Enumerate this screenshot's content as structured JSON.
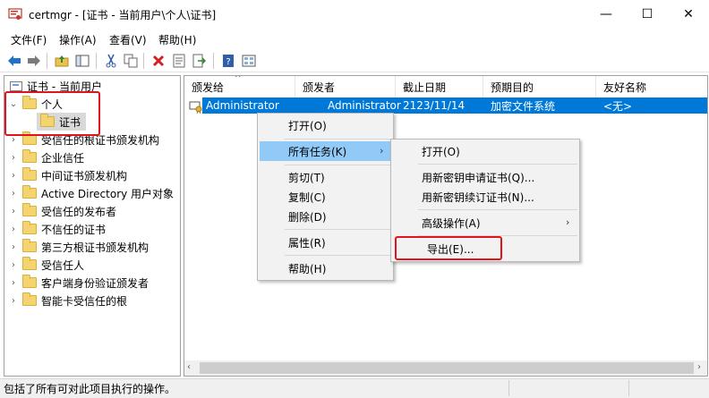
{
  "window": {
    "title": "certmgr - [证书 - 当前用户\\个人\\证书]",
    "controls": {
      "minimize": "—",
      "maximize": "☐",
      "close": "✕"
    }
  },
  "menubar": {
    "items": [
      "文件(F)",
      "操作(A)",
      "查看(V)",
      "帮助(H)"
    ]
  },
  "toolbar": {
    "icons": [
      "back-icon",
      "forward-icon",
      "up-folder-icon",
      "show-hide-tree-icon",
      "cut-icon",
      "copy-icon",
      "delete-icon",
      "properties-icon",
      "export-list-icon",
      "help-icon",
      "view-icon"
    ]
  },
  "tree": {
    "root": "证书 - 当前用户",
    "items": [
      {
        "label": "个人",
        "expanded": true
      },
      {
        "label": "证书",
        "child": true,
        "selected": true
      },
      {
        "label": "受信任的根证书颁发机构"
      },
      {
        "label": "企业信任"
      },
      {
        "label": "中间证书颁发机构"
      },
      {
        "label": "Active Directory 用户对象"
      },
      {
        "label": "受信任的发布者"
      },
      {
        "label": "不信任的证书"
      },
      {
        "label": "第三方根证书颁发机构"
      },
      {
        "label": "受信任人"
      },
      {
        "label": "客户端身份验证颁发者"
      },
      {
        "label": "智能卡受信任的根"
      }
    ]
  },
  "list": {
    "columns": [
      "颁发给",
      "颁发者",
      "截止日期",
      "预期目的",
      "友好名称"
    ],
    "rows": [
      {
        "issued_to": "Administrator",
        "issued_by": "Administrator",
        "expires": "2123/11/14",
        "purpose": "加密文件系统",
        "friendly": "<无>"
      }
    ]
  },
  "context_menu": {
    "items": [
      "打开(O)",
      "所有任务(K)",
      "剪切(T)",
      "复制(C)",
      "删除(D)",
      "属性(R)",
      "帮助(H)"
    ],
    "highlighted": "所有任务(K)"
  },
  "submenu": {
    "items": [
      "打开(O)",
      "用新密钥申请证书(Q)...",
      "用新密钥续订证书(N)...",
      "高级操作(A)",
      "导出(E)..."
    ]
  },
  "statusbar": {
    "text": "包括了所有可对此项目执行的操作。"
  },
  "colors": {
    "selection": "#0078d7",
    "menu_highlight": "#91c9f7",
    "annotation": "#e1141b"
  }
}
